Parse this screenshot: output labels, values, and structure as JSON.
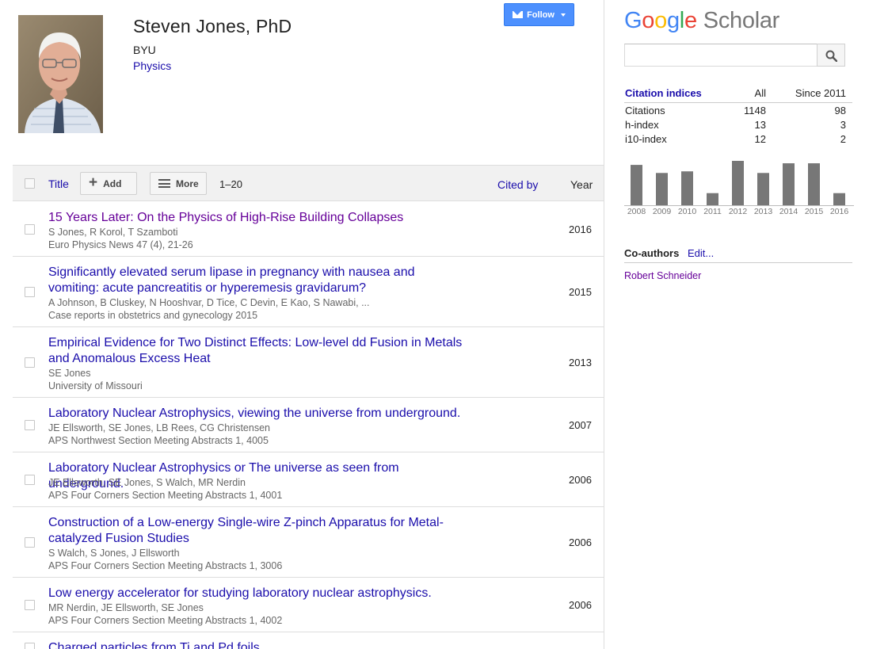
{
  "profile": {
    "name": "Steven Jones",
    "suffix": ", PhD",
    "affiliation": "BYU",
    "field": "Physics",
    "follow_label": "Follow"
  },
  "toolbar": {
    "title_label": "Title",
    "add_label": "Add",
    "more_label": "More",
    "range": "1–20",
    "cited_by_label": "Cited by",
    "year_label": "Year"
  },
  "articles": [
    {
      "title": "15 Years Later: On the Physics of High-Rise Building Collapses",
      "authors": "S Jones, R Korol, T Szamboti",
      "venue": "Euro Physics News 47 (4), 21-26",
      "year": "2016",
      "visited": true
    },
    {
      "title": "Significantly elevated serum lipase in pregnancy with nausea and vomiting: acute pancreatitis or hyperemesis gravidarum?",
      "authors": "A Johnson, B Cluskey, N Hooshvar, D Tice, C Devin, E Kao, S Nawabi, ...",
      "venue": "Case reports in obstetrics and gynecology 2015",
      "year": "2015",
      "visited": false
    },
    {
      "title": "Empirical Evidence for Two Distinct Effects: Low-level dd Fusion in Metals and Anomalous Excess Heat",
      "authors": "SE Jones",
      "venue": "University of Missouri",
      "year": "2013",
      "visited": false
    },
    {
      "title": "Laboratory Nuclear Astrophysics, viewing the universe from underground.",
      "authors": "JE Ellsworth, SE Jones, LB Rees, CG Christensen",
      "venue": "APS Northwest Section Meeting Abstracts 1, 4005",
      "year": "2007",
      "visited": false
    },
    {
      "title": "Laboratory Nuclear Astrophysics or The universe as seen from underground.",
      "authors": "JE Ellsworth, SE Jones, S Walch, MR Nerdin",
      "venue": "APS Four Corners Section Meeting Abstracts 1, 4001",
      "year": "2006",
      "visited": false
    },
    {
      "title": "Construction of a Low-energy Single-wire Z-pinch Apparatus for Metal-catalyzed Fusion Studies",
      "authors": "S Walch, S Jones, J Ellsworth",
      "venue": "APS Four Corners Section Meeting Abstracts 1, 3006",
      "year": "2006",
      "visited": false
    },
    {
      "title": "Low energy accelerator for studying laboratory nuclear astrophysics.",
      "authors": "MR Nerdin, JE Ellsworth, SE Jones",
      "venue": "APS Four Corners Section Meeting Abstracts 1, 4002",
      "year": "2006",
      "visited": false
    },
    {
      "title": "Charged particles from Ti and Pd foils",
      "authors": "",
      "venue": "",
      "year": "",
      "visited": false
    }
  ],
  "sidebar": {
    "logo_google": [
      "G",
      "o",
      "o",
      "g",
      "l",
      "e"
    ],
    "logo_scholar": "Scholar",
    "search_placeholder": "",
    "citation_indices": {
      "title": "Citation indices",
      "col_all": "All",
      "col_since": "Since 2011",
      "rows": [
        {
          "label": "Citations",
          "all": "1148",
          "since": "98"
        },
        {
          "label": "h-index",
          "all": "13",
          "since": "3"
        },
        {
          "label": "i10-index",
          "all": "12",
          "since": "2"
        }
      ]
    },
    "coauthors_title": "Co-authors",
    "coauthors_edit": "Edit...",
    "coauthors": [
      "Robert Schneider"
    ]
  },
  "chart_data": {
    "type": "bar",
    "categories": [
      "2008",
      "2009",
      "2010",
      "2011",
      "2012",
      "2013",
      "2014",
      "2015",
      "2016"
    ],
    "values": [
      50,
      40,
      42,
      15,
      55,
      40,
      52,
      52,
      15
    ],
    "bar_color": "#777777"
  },
  "colors": {
    "link": "#1a0dab",
    "visited": "#660099",
    "follow_button": "#4d90fe"
  }
}
